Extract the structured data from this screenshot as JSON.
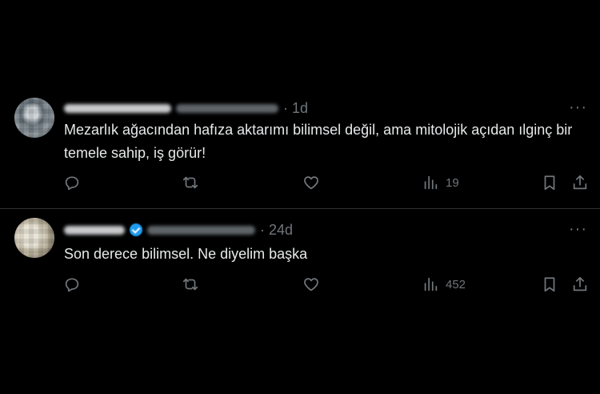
{
  "posts": [
    {
      "time": "· 1d",
      "text": "Mezarlık ağacından hafıza aktarımı bilimsel değil, ama mitolojik açıdan ılginç bir temele sahip, iş görür!",
      "views": "19",
      "more": "···"
    },
    {
      "time": "· 24d",
      "text": "Son derece bilimsel. Ne diyelim başka",
      "views": "452",
      "more": "···"
    }
  ],
  "icons": {
    "reply": "reply-icon",
    "retweet": "retweet-icon",
    "like": "heart-icon",
    "views": "views-icon",
    "bookmark": "bookmark-icon",
    "share": "share-icon",
    "verified": "verified-badge-icon"
  },
  "colors": {
    "background": "#000000",
    "text": "#e7e9ea",
    "muted": "#71767b",
    "divider": "#2f3336",
    "verified": "#1d9bf0"
  }
}
